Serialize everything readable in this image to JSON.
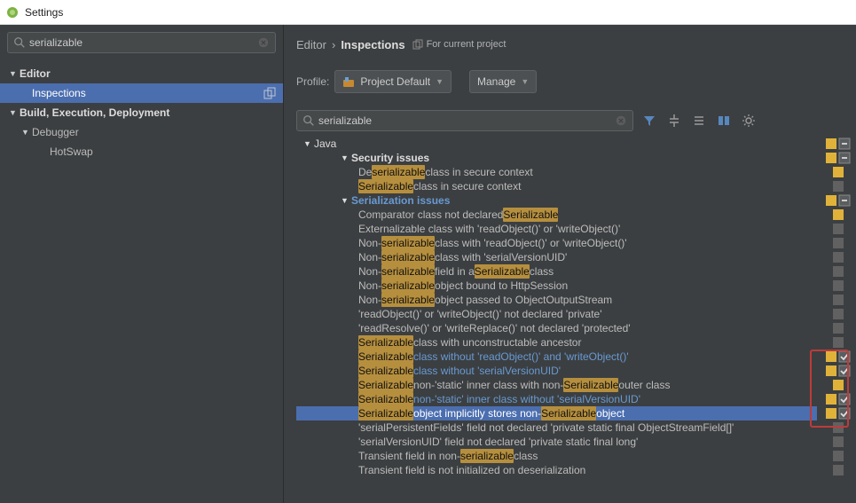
{
  "window_title": "Settings",
  "sidebar": {
    "search_value": "serializable",
    "nodes": [
      {
        "label": "Editor",
        "bold": true,
        "expanded": true
      },
      {
        "label": "Inspections",
        "level": 1,
        "selected": true,
        "badge": "copy"
      },
      {
        "label": "Build, Execution, Deployment",
        "bold": true,
        "expanded": true
      },
      {
        "label": "Debugger",
        "level": 1,
        "expanded": true
      },
      {
        "label": "HotSwap",
        "level": 2
      }
    ]
  },
  "breadcrumb": {
    "section": "Editor",
    "sub": "Inspections",
    "note": "For current project"
  },
  "profile": {
    "label": "Profile:",
    "value": "Project Default",
    "manage": "Manage"
  },
  "panel": {
    "search_value": "serializable",
    "toolbar_icons": [
      "filter",
      "expand",
      "collapse",
      "diff",
      "gear"
    ]
  },
  "tree": {
    "root": "Java",
    "groups": [
      {
        "name": "Security issues",
        "items": [
          {
            "parts": [
              "De",
              "serializable",
              " class in secure context"
            ],
            "hl": [
              1
            ]
          },
          {
            "parts": [
              "Serializable",
              " class in secure context"
            ],
            "hl": [
              0
            ]
          }
        ],
        "gutter": [
          {
            "sev": "warn"
          },
          {
            "sev": "off"
          }
        ]
      },
      {
        "name": "Serialization issues",
        "items": [
          {
            "parts": [
              "Comparator class not declared ",
              "Serializable"
            ],
            "hl": [
              1
            ]
          },
          {
            "parts": [
              "Externalizable class with 'readObject()' or 'writeObject()'"
            ],
            "hl": []
          },
          {
            "parts": [
              "Non-",
              "serializable",
              " class with 'readObject()' or 'writeObject()'"
            ],
            "hl": [
              1
            ]
          },
          {
            "parts": [
              "Non-",
              "serializable",
              " class with 'serialVersionUID'"
            ],
            "hl": [
              1
            ]
          },
          {
            "parts": [
              "Non-",
              "serializable",
              " field in a ",
              "Serializable",
              " class"
            ],
            "hl": [
              1,
              3
            ]
          },
          {
            "parts": [
              "Non-",
              "serializable",
              " object bound to HttpSession"
            ],
            "hl": [
              1
            ]
          },
          {
            "parts": [
              "Non-",
              "serializable",
              " object passed to ObjectOutputStream"
            ],
            "hl": [
              1
            ]
          },
          {
            "parts": [
              "'readObject()' or 'writeObject()' not declared 'private'"
            ],
            "hl": []
          },
          {
            "parts": [
              "'readResolve()' or 'writeReplace()' not declared 'protected'"
            ],
            "hl": []
          },
          {
            "parts": [
              "Serializable",
              " class with unconstructable ancestor"
            ],
            "hl": [
              0
            ]
          },
          {
            "parts": [
              "Serializable",
              " class without 'readObject()' and 'writeObject()'"
            ],
            "hl": [
              0
            ],
            "blue": true
          },
          {
            "parts": [
              "Serializable",
              " class without 'serialVersionUID'"
            ],
            "hl": [
              0
            ],
            "blue": true
          },
          {
            "parts": [
              "Serializable",
              " non-'static' inner class with non-",
              "Serializable",
              " outer class"
            ],
            "hl": [
              0,
              2
            ]
          },
          {
            "parts": [
              "Serializable",
              " non-'static' inner class without 'serialVersionUID'"
            ],
            "hl": [
              0
            ],
            "blue": true
          },
          {
            "parts": [
              "Serializable",
              " object implicitly stores non-",
              "Serializable",
              " object"
            ],
            "hl": [
              0,
              2
            ],
            "selected": true
          },
          {
            "parts": [
              "'serialPersistentFields' field not declared 'private static final ObjectStreamField[]'"
            ],
            "hl": []
          },
          {
            "parts": [
              "'serialVersionUID' field not declared 'private static final long'"
            ],
            "hl": []
          },
          {
            "parts": [
              "Transient field in non-",
              "serializable",
              " class"
            ],
            "hl": [
              1
            ]
          },
          {
            "parts": [
              "Transient field is not initialized on deserialization"
            ],
            "hl": []
          }
        ],
        "gutter": [
          {
            "sev": "warn"
          },
          {
            "sev": "off"
          },
          {
            "sev": "off"
          },
          {
            "sev": "off"
          },
          {
            "sev": "off"
          },
          {
            "sev": "off"
          },
          {
            "sev": "off"
          },
          {
            "sev": "off"
          },
          {
            "sev": "off"
          },
          {
            "sev": "off"
          },
          {
            "sev": "warn",
            "chk": true
          },
          {
            "sev": "warn",
            "chk": true
          },
          {
            "sev": "warn"
          },
          {
            "sev": "warn",
            "chk": true
          },
          {
            "sev": "warn",
            "chk": true
          },
          {
            "sev": "off"
          },
          {
            "sev": "off"
          },
          {
            "sev": "off"
          },
          {
            "sev": "off"
          }
        ]
      }
    ],
    "group_gutters": [
      {
        "sev": "warn",
        "chk_box": true
      },
      {
        "sev": "warn",
        "chk_box": true
      }
    ]
  }
}
